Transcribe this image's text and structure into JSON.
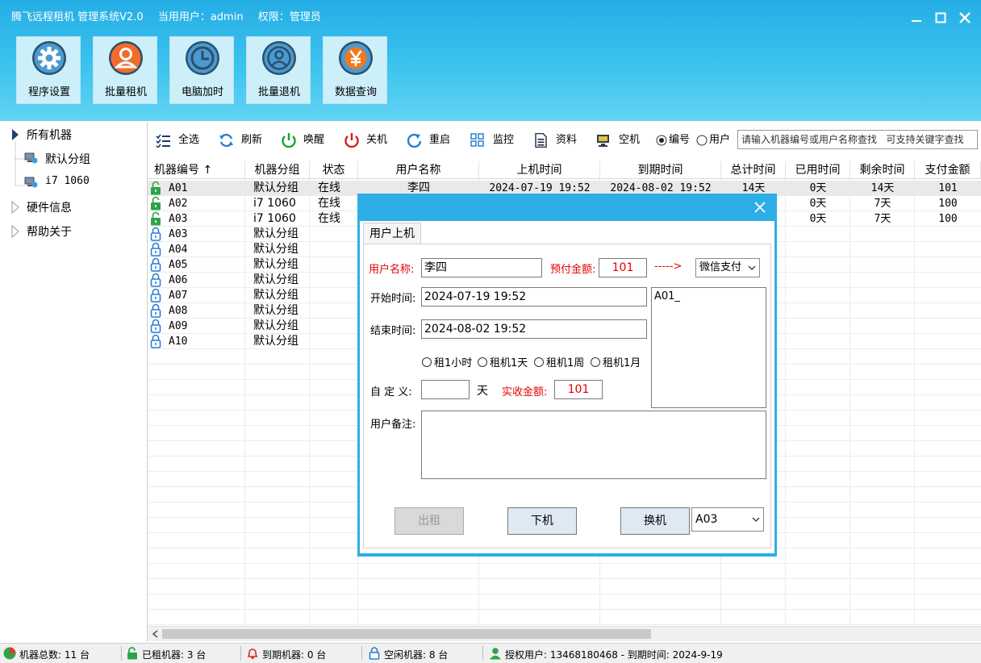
{
  "window": {
    "title": "腾飞远程租机 管理系统V2.0",
    "current_user": "当用用户：admin",
    "permission": "权限：管理员"
  },
  "nav_buttons": [
    {
      "label": "程序设置",
      "icon": "gear-icon"
    },
    {
      "label": "批量租机",
      "icon": "user-icon"
    },
    {
      "label": "电脑加时",
      "icon": "clock-icon"
    },
    {
      "label": "批量退机",
      "icon": "user-circle-icon"
    },
    {
      "label": "数据查询",
      "icon": "yen-icon"
    }
  ],
  "tree": {
    "root": "所有机器",
    "groups": [
      "默认分组",
      "i7 1060"
    ],
    "others": [
      "硬件信息",
      "帮助关于"
    ]
  },
  "toolbar": {
    "select_all": "全选",
    "refresh": "刷新",
    "wake": "唤醒",
    "shutdown": "关机",
    "restart": "重启",
    "monitor": "监控",
    "info": "资料",
    "idle": "空机",
    "radio_id": "编号",
    "radio_user": "用户",
    "search_placeholder": "请输入机器编号或用户名称查找   可支持关键字查找"
  },
  "table": {
    "columns": [
      "机器编号 ↑",
      "机器分组",
      "状态",
      "用户名称",
      "上机时间",
      "到期时间",
      "总计时间",
      "已用时间",
      "剩余时间",
      "支付金额"
    ],
    "rows": [
      {
        "id": "A01",
        "group": "默认分组",
        "status": "在线",
        "user": "李四",
        "start": "2024-07-19 19:52",
        "end": "2024-08-02 19:52",
        "total": "14天",
        "used": "0天",
        "remain": "14天",
        "paid": "101",
        "locked": false
      },
      {
        "id": "A02",
        "group": "i7 1060",
        "status": "在线",
        "user": "",
        "start": "",
        "end": "",
        "total": "",
        "used": "0天",
        "remain": "7天",
        "paid": "100",
        "locked": false
      },
      {
        "id": "A03",
        "group": "i7 1060",
        "status": "在线",
        "user": "",
        "start": "",
        "end": "",
        "total": "",
        "used": "0天",
        "remain": "7天",
        "paid": "100",
        "locked": false
      },
      {
        "id": "A03",
        "group": "默认分组",
        "status": "",
        "user": "",
        "start": "",
        "end": "",
        "total": "",
        "used": "",
        "remain": "",
        "paid": "",
        "locked": true
      },
      {
        "id": "A04",
        "group": "默认分组",
        "status": "",
        "user": "",
        "start": "",
        "end": "",
        "total": "",
        "used": "",
        "remain": "",
        "paid": "",
        "locked": true
      },
      {
        "id": "A05",
        "group": "默认分组",
        "status": "",
        "user": "",
        "start": "",
        "end": "",
        "total": "",
        "used": "",
        "remain": "",
        "paid": "",
        "locked": true
      },
      {
        "id": "A06",
        "group": "默认分组",
        "status": "",
        "user": "",
        "start": "",
        "end": "",
        "total": "",
        "used": "",
        "remain": "",
        "paid": "",
        "locked": true
      },
      {
        "id": "A07",
        "group": "默认分组",
        "status": "",
        "user": "",
        "start": "",
        "end": "",
        "total": "",
        "used": "",
        "remain": "",
        "paid": "",
        "locked": true
      },
      {
        "id": "A08",
        "group": "默认分组",
        "status": "",
        "user": "",
        "start": "",
        "end": "",
        "total": "",
        "used": "",
        "remain": "",
        "paid": "",
        "locked": true
      },
      {
        "id": "A09",
        "group": "默认分组",
        "status": "",
        "user": "",
        "start": "",
        "end": "",
        "total": "",
        "used": "",
        "remain": "",
        "paid": "",
        "locked": true
      },
      {
        "id": "A10",
        "group": "默认分组",
        "status": "",
        "user": "",
        "start": "",
        "end": "",
        "total": "",
        "used": "",
        "remain": "",
        "paid": "",
        "locked": true
      }
    ]
  },
  "dialog": {
    "tab": "用户上机",
    "username_label": "用户名称:",
    "username_value": "李四",
    "prepay_label": "预付金额:",
    "prepay_value": "101",
    "arrow": "----->",
    "payment_method": "微信支付",
    "start_label": "开始时间:",
    "start_value": "2024-07-19 19:52",
    "end_label": "结束时间:",
    "end_value": "2024-08-02 19:52",
    "machine_list": "A01_",
    "rent_options": [
      "租1小时",
      "租机1天",
      "租机1周",
      "租机1月"
    ],
    "custom_label": "自 定 义:",
    "custom_value": "",
    "day_unit": "天",
    "actual_label": "实收金额:",
    "actual_value": "101",
    "note_label": "用户备注:",
    "note_value": "",
    "rent_button": "出租",
    "offline_button": "下机",
    "swap_button": "换机",
    "swap_target": "A03"
  },
  "status_bar": {
    "total": "机器总数: 11 台",
    "rented": "已租机器: 3 台",
    "expired": "到期机器: 0 台",
    "idle": "空闲机器: 8 台",
    "license": "授权用户: 13468180468 - 到期时间: 2024-9-19"
  },
  "colors": {
    "header_top": "#25aee6",
    "header_bottom": "#63d3f3",
    "dialog_frame": "#2eaee6",
    "alert_red": "#e60000"
  }
}
